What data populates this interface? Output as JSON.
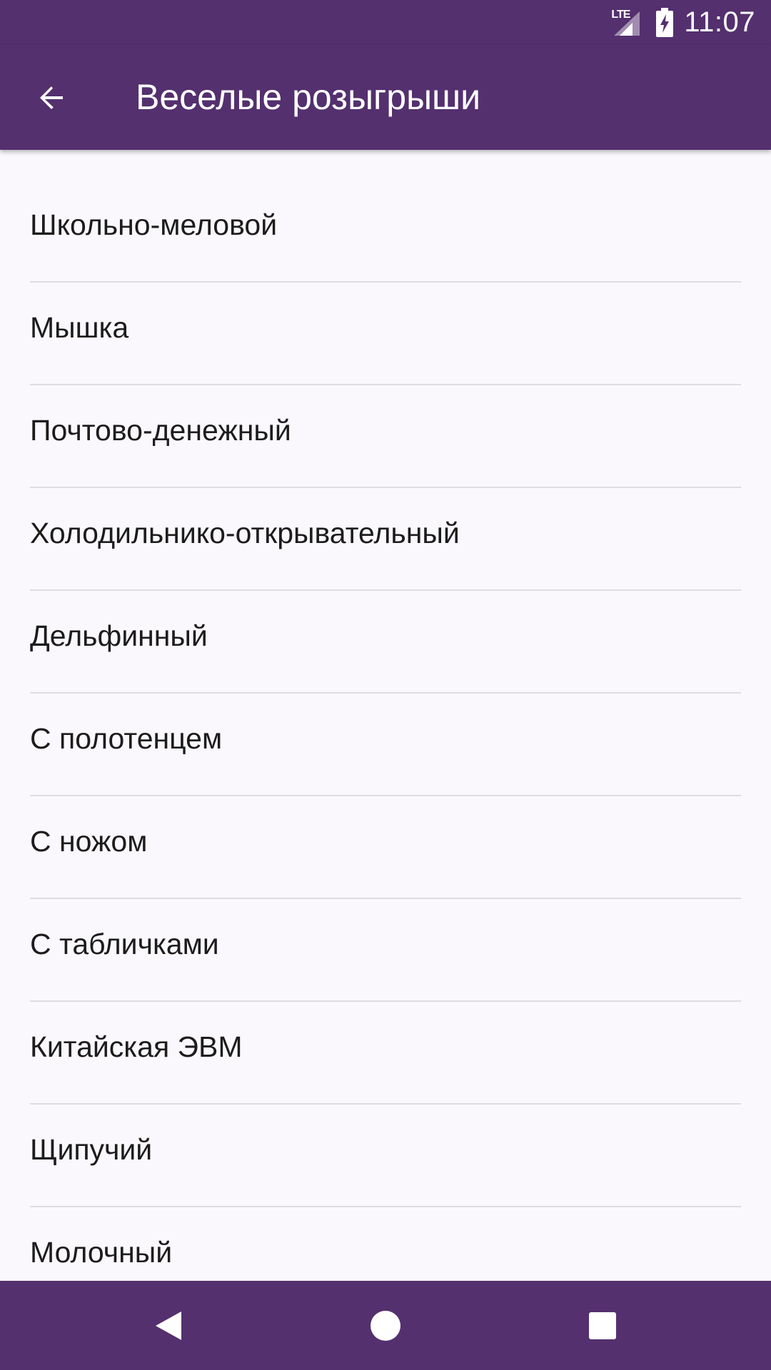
{
  "status_bar": {
    "network_label": "LTE",
    "time": "11:07",
    "icons": [
      "lte-signal-icon",
      "battery-charging-icon"
    ]
  },
  "app_bar": {
    "title": "Веселые розыгрыши",
    "back_icon": "arrow-back-icon"
  },
  "list": {
    "items": [
      {
        "label": "Школьно-меловой"
      },
      {
        "label": "Мышка"
      },
      {
        "label": "Почтово-денежный"
      },
      {
        "label": "Холодильнико-открывательный"
      },
      {
        "label": "Дельфинный"
      },
      {
        "label": "С полотенцем"
      },
      {
        "label": "С ножом"
      },
      {
        "label": "С табличками"
      },
      {
        "label": "Китайская ЭВМ"
      },
      {
        "label": "Щипучий"
      },
      {
        "label": "Молочный"
      }
    ]
  },
  "nav_bar": {
    "icons": [
      "nav-back-icon",
      "nav-home-icon",
      "nav-recents-icon"
    ]
  },
  "colors": {
    "primary": "#54306e",
    "background": "#faf8fc",
    "divider": "#dddde0",
    "text": "#1c1c1c",
    "on_primary": "#ffffff"
  }
}
